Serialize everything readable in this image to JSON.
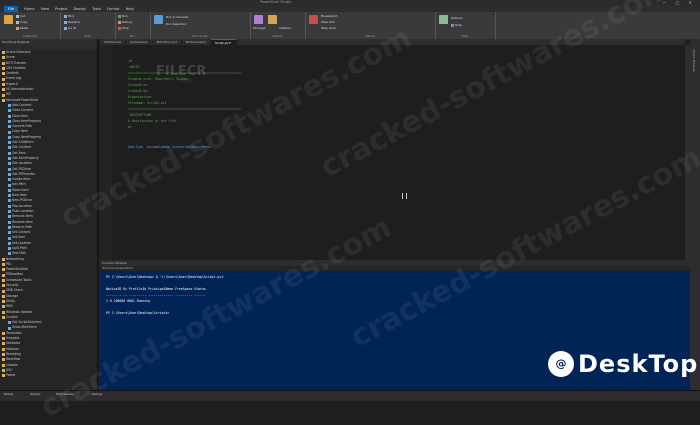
{
  "window": {
    "title": "PowerShell Studio",
    "controls": [
      "—",
      "□",
      "✕"
    ]
  },
  "menu": [
    "File",
    "Home",
    "View",
    "Project",
    "Deploy",
    "Tools",
    "Format",
    "Help"
  ],
  "ribbon": {
    "groups": [
      {
        "label": "Clipboard",
        "items": [
          "Cut",
          "Copy",
          "Paste"
        ]
      },
      {
        "label": "Edit",
        "items": [
          "Find",
          "Replace",
          "Go To"
        ]
      },
      {
        "label": "Run",
        "items": [
          "Run",
          "Debug",
          "Stop"
        ]
      },
      {
        "label": "Run Script",
        "items": [
          "Run in Console",
          "Run Selection"
        ]
      },
      {
        "label": "Deploy",
        "items": [
          "Package",
          "Installer"
        ]
      },
      {
        "label": "Debug",
        "items": [
          "Breakpoint",
          "Step Into",
          "Step Over"
        ]
      },
      {
        "label": "Help",
        "items": [
          "Options",
          "Help"
        ]
      }
    ]
  },
  "doc_tabs": [
    "Startup.pss",
    "Globals.ps1",
    "MainForm.psf",
    "Module.psm1",
    "Script.ps1*"
  ],
  "left_panel": {
    "title": "Functions Explorer",
    "tree": [
      "Active Directory",
      "Azure",
      "BITS Transfer",
      "CIM Cmdlets",
      "Cmdlets",
      "Event Log",
      "Hyper-V",
      "IIS Administration",
      "ISE",
      "Microsoft.PowerShell",
      "Add-Content",
      "Clear-Content",
      "Clear-Item",
      "Clear-ItemProperty",
      "Convert-Path",
      "Copy-Item",
      "Copy-ItemProperty",
      "Get-ChildItem",
      "Get-Content",
      "Get-Item",
      "Get-ItemProperty",
      "Get-Location",
      "Get-PSDrive",
      "Get-PSProvider",
      "Invoke-Item",
      "Join-Path",
      "Move-Item",
      "New-Item",
      "New-PSDrive",
      "Pop-Location",
      "Push-Location",
      "Remove-Item",
      "Rename-Item",
      "Resolve-Path",
      "Set-Content",
      "Set-Item",
      "Set-Location",
      "Split-Path",
      "Test-Path",
      "Networking",
      "PKI",
      "PowerShellGet",
      "PSReadline",
      "Scheduled Tasks",
      "Security",
      "SMB Share",
      "Storage",
      "Utility",
      "WMI",
      "Windows Update",
      "Custom",
      "Get-ScriptDirectory",
      "Show-MainForm",
      "Templates",
      "Snippets",
      "Variables",
      "Modules",
      "Remoting",
      "Workflow",
      "Classes",
      "DSC",
      "Pester"
    ]
  },
  "editor": {
    "lines": [
      {
        "cls": "c-comment",
        "text": "<#"
      },
      {
        "cls": "c-comment",
        "text": "    .NOTES"
      },
      {
        "cls": "c-comment",
        "text": "    ==========================================================="
      },
      {
        "cls": "c-comment",
        "text": "     Created with:  PowerShell Studio"
      },
      {
        "cls": "c-comment",
        "text": "     Created on:    "
      },
      {
        "cls": "c-comment",
        "text": "     Created by:    "
      },
      {
        "cls": "c-comment",
        "text": "     Organization:  "
      },
      {
        "cls": "c-comment",
        "text": "     Filename:      Script.ps1"
      },
      {
        "cls": "c-comment",
        "text": "    ==========================================================="
      },
      {
        "cls": "c-comment",
        "text": "    .DESCRIPTION"
      },
      {
        "cls": "c-comment",
        "text": "        A description of the file."
      },
      {
        "cls": "c-comment",
        "text": "#>"
      },
      {
        "cls": "c-ident",
        "text": ""
      },
      {
        "cls": "c-kw",
        "text": "Add-Type -AssemblyName System.Windows.Forms"
      }
    ]
  },
  "console": {
    "header": "Console Window",
    "subheader": "Windows PowerShell",
    "lines": [
      "PS C:\\Users\\User\\Desktop> & 'C:\\Users\\User\\Desktop\\Script.ps1'",
      "",
      "NativeID Rc ProfileId PrincipalName    FreeSpace       Status",
      "-------- -- --------- -------------    ---------       ------",
      "1        0              100000 0001   Running",
      "",
      "PS C:\\Users\\User\\Desktop\\Scripts>"
    ]
  },
  "side_strip": "Object Browser",
  "statusbar": [
    "Ready",
    "Output",
    "Find Results",
    "Debug"
  ],
  "watermark": {
    "text": "cracked-softwares.com",
    "brand": "FILECR",
    "brand_sub": ".com",
    "desk_icon": "@",
    "desk_text": "DeskTop"
  }
}
